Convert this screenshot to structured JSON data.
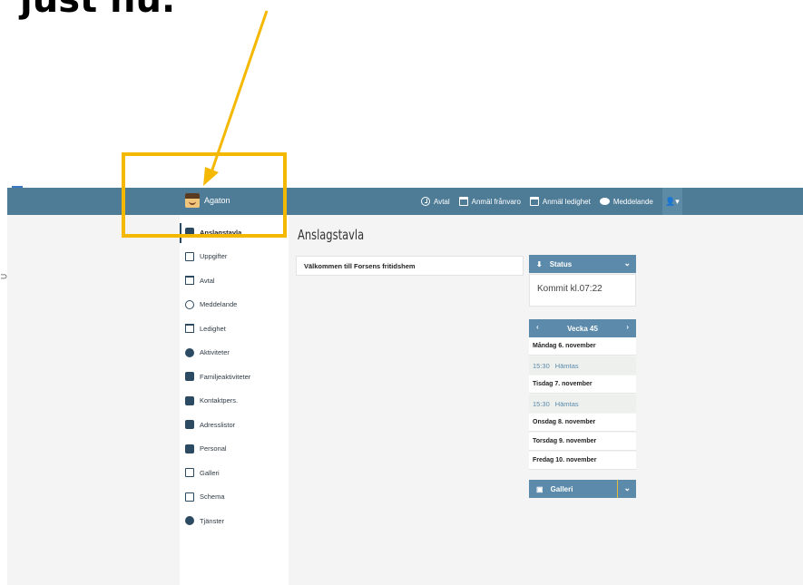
{
  "caption": "just nu.",
  "user": {
    "name": "Agaton"
  },
  "top_nav": [
    {
      "label": "Avtal",
      "icon": "clock-icon"
    },
    {
      "label": "Anmäl frånvaro",
      "icon": "calendar-icon"
    },
    {
      "label": "Anmäl ledighet",
      "icon": "calendar-icon"
    },
    {
      "label": "Meddelande",
      "icon": "chat-bubble-icon"
    }
  ],
  "user_menu": {
    "glyph": "👤▾"
  },
  "sidebar": {
    "items": [
      {
        "label": "Anslagstavla",
        "icon": "pin-icon",
        "active": true
      },
      {
        "label": "Uppgifter",
        "icon": "list-icon"
      },
      {
        "label": "Avtal",
        "icon": "calendar-icon"
      },
      {
        "label": "Meddelande",
        "icon": "chat-bubble-icon"
      },
      {
        "label": "Ledighet",
        "icon": "calendar-icon"
      },
      {
        "label": "Aktiviteter",
        "icon": "ball-icon"
      },
      {
        "label": "Familjeaktiviteter",
        "icon": "family-icon"
      },
      {
        "label": "Kontaktpers.",
        "icon": "people-icon"
      },
      {
        "label": "Adresslistor",
        "icon": "phone-icon"
      },
      {
        "label": "Personal",
        "icon": "person-icon"
      },
      {
        "label": "Galleri",
        "icon": "image-icon"
      },
      {
        "label": "Schema",
        "icon": "table-icon"
      },
      {
        "label": "Tjänster",
        "icon": "info-icon"
      }
    ]
  },
  "main": {
    "title": "Anslagstavla",
    "welcome": "Välkommen till Forsens fritidshem"
  },
  "status_panel": {
    "title": "Status",
    "text": "Kommit kl.07:22"
  },
  "week_panel": {
    "title": "Vecka 45",
    "days": [
      {
        "label": "Måndag 6. november",
        "event": {
          "time": "15:30",
          "text": "Hämtas"
        }
      },
      {
        "label": "Tisdag 7. november",
        "event": {
          "time": "15:30",
          "text": "Hämtas"
        }
      },
      {
        "label": "Onsdag 8. november"
      },
      {
        "label": "Torsdag 9. november"
      },
      {
        "label": "Fredag 10. november"
      }
    ]
  },
  "gallery_panel": {
    "title": "Galleri"
  },
  "colors": {
    "topbar": "#4e7c97",
    "panel_header": "#5b8aaa",
    "highlight": "#f5b800",
    "event_text": "#5b8aaa"
  }
}
